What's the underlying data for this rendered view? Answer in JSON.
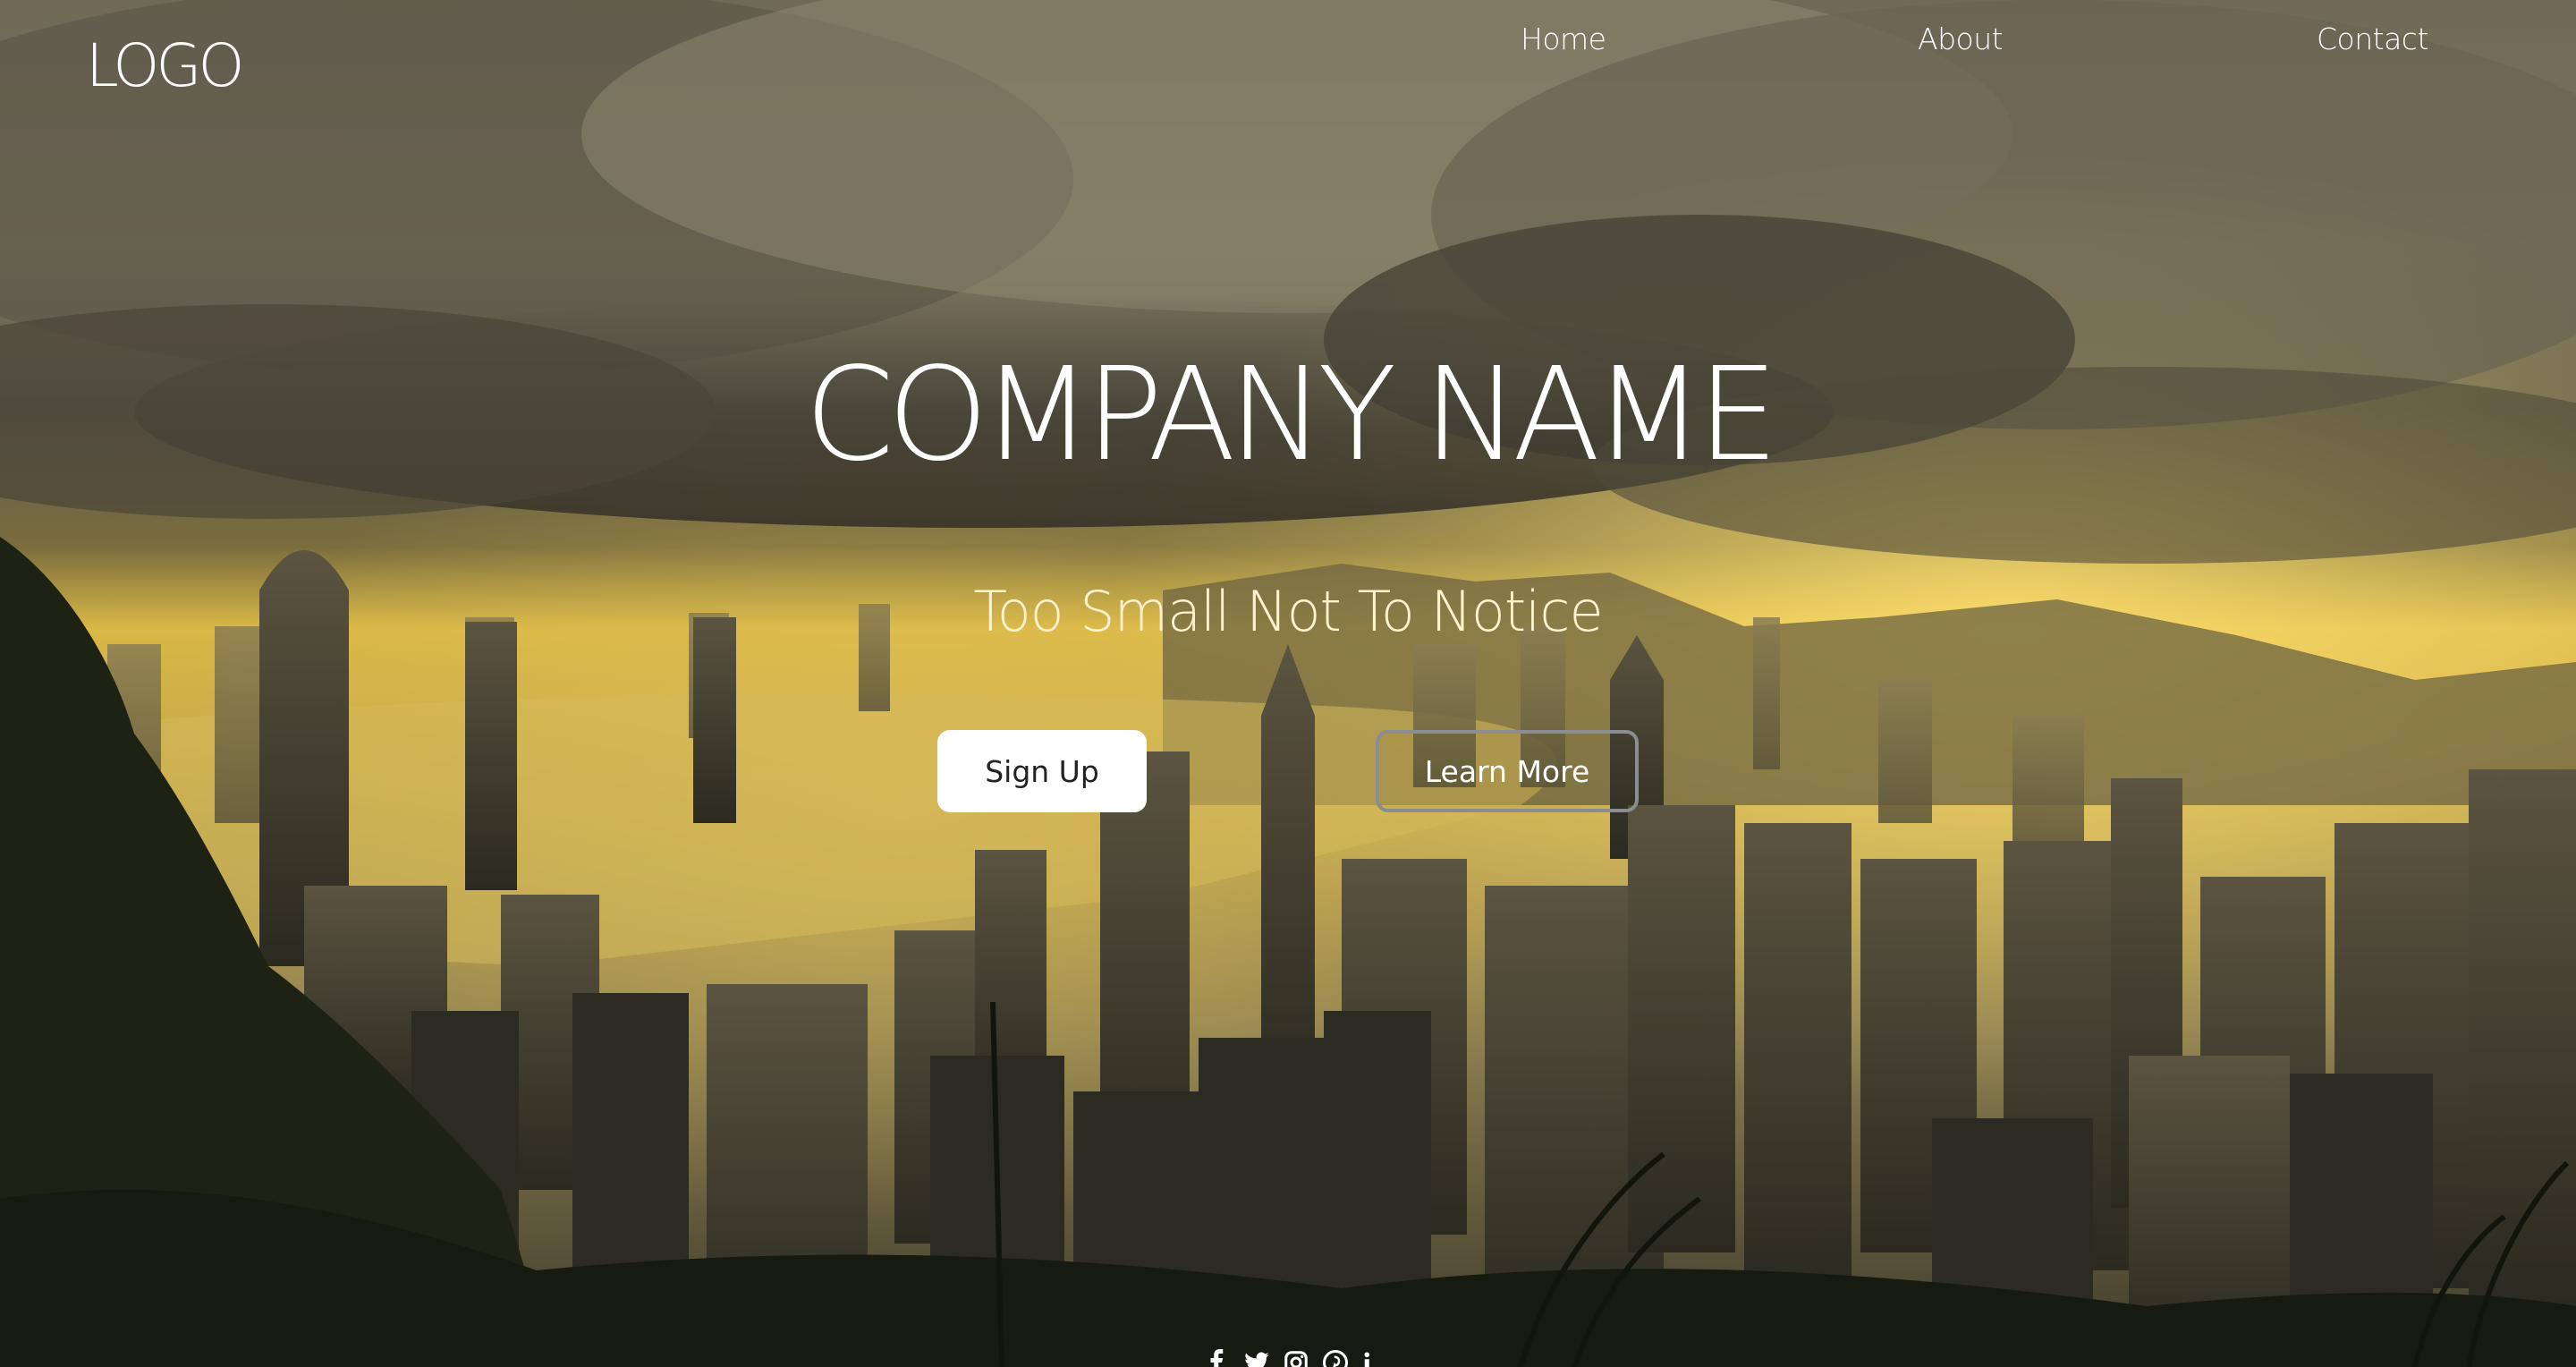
{
  "header": {
    "logo": "LOGO",
    "nav": [
      {
        "label": "Home"
      },
      {
        "label": "About"
      },
      {
        "label": "Contact"
      }
    ]
  },
  "hero": {
    "title": "COMPANY NAME",
    "tagline": "Too Small Not To Notice",
    "primary_button": "Sign Up",
    "secondary_button": "Learn More"
  },
  "social_icons": [
    "facebook-icon",
    "twitter-icon",
    "instagram-icon",
    "pinterest-icon",
    "linkedin-icon"
  ],
  "colors": {
    "text": "#ffffff",
    "button_bg": "#ffffff",
    "button_text": "#222222",
    "outline_button_border": "#8a8d92",
    "sky_storm": "#5a5546",
    "glow": "#f3cf55"
  }
}
